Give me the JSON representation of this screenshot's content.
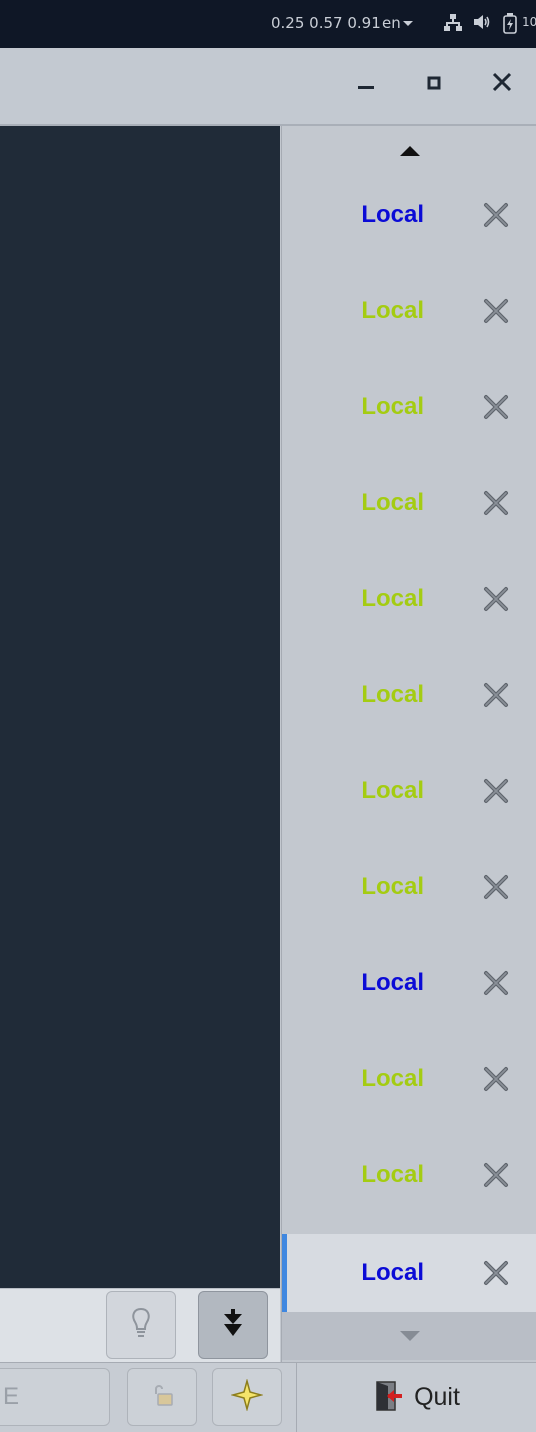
{
  "top_panel": {
    "load": "0.25 0.57 0.91",
    "language": "en",
    "battery_text": "10",
    "icons": [
      "network-icon",
      "volume-icon",
      "battery-icon"
    ]
  },
  "window_controls": [
    "minimize-icon",
    "maximize-icon",
    "close-icon"
  ],
  "tabs": [
    {
      "label": "Local",
      "color": "#0b0bd6",
      "active": false
    },
    {
      "label": "Local",
      "color": "#a4cc12",
      "active": false
    },
    {
      "label": "Local",
      "color": "#a4cc12",
      "active": false
    },
    {
      "label": "Local",
      "color": "#a4cc12",
      "active": false
    },
    {
      "label": "Local",
      "color": "#a4cc12",
      "active": false
    },
    {
      "label": "Local",
      "color": "#a4cc12",
      "active": false
    },
    {
      "label": "Local",
      "color": "#a4cc12",
      "active": false
    },
    {
      "label": "Local",
      "color": "#a4cc12",
      "active": false
    },
    {
      "label": "Local",
      "color": "#0b0bd6",
      "active": false
    },
    {
      "label": "Local",
      "color": "#a4cc12",
      "active": false
    },
    {
      "label": "Local",
      "color": "#a4cc12",
      "active": false
    },
    {
      "label": "Local",
      "color": "#0b0bd6",
      "active": true
    }
  ],
  "bottom_bar": {
    "input_fragment": "E",
    "quit_label": "Quit"
  },
  "colors": {
    "accent": "#3f87e0",
    "terminal_bg": "#202b38"
  }
}
